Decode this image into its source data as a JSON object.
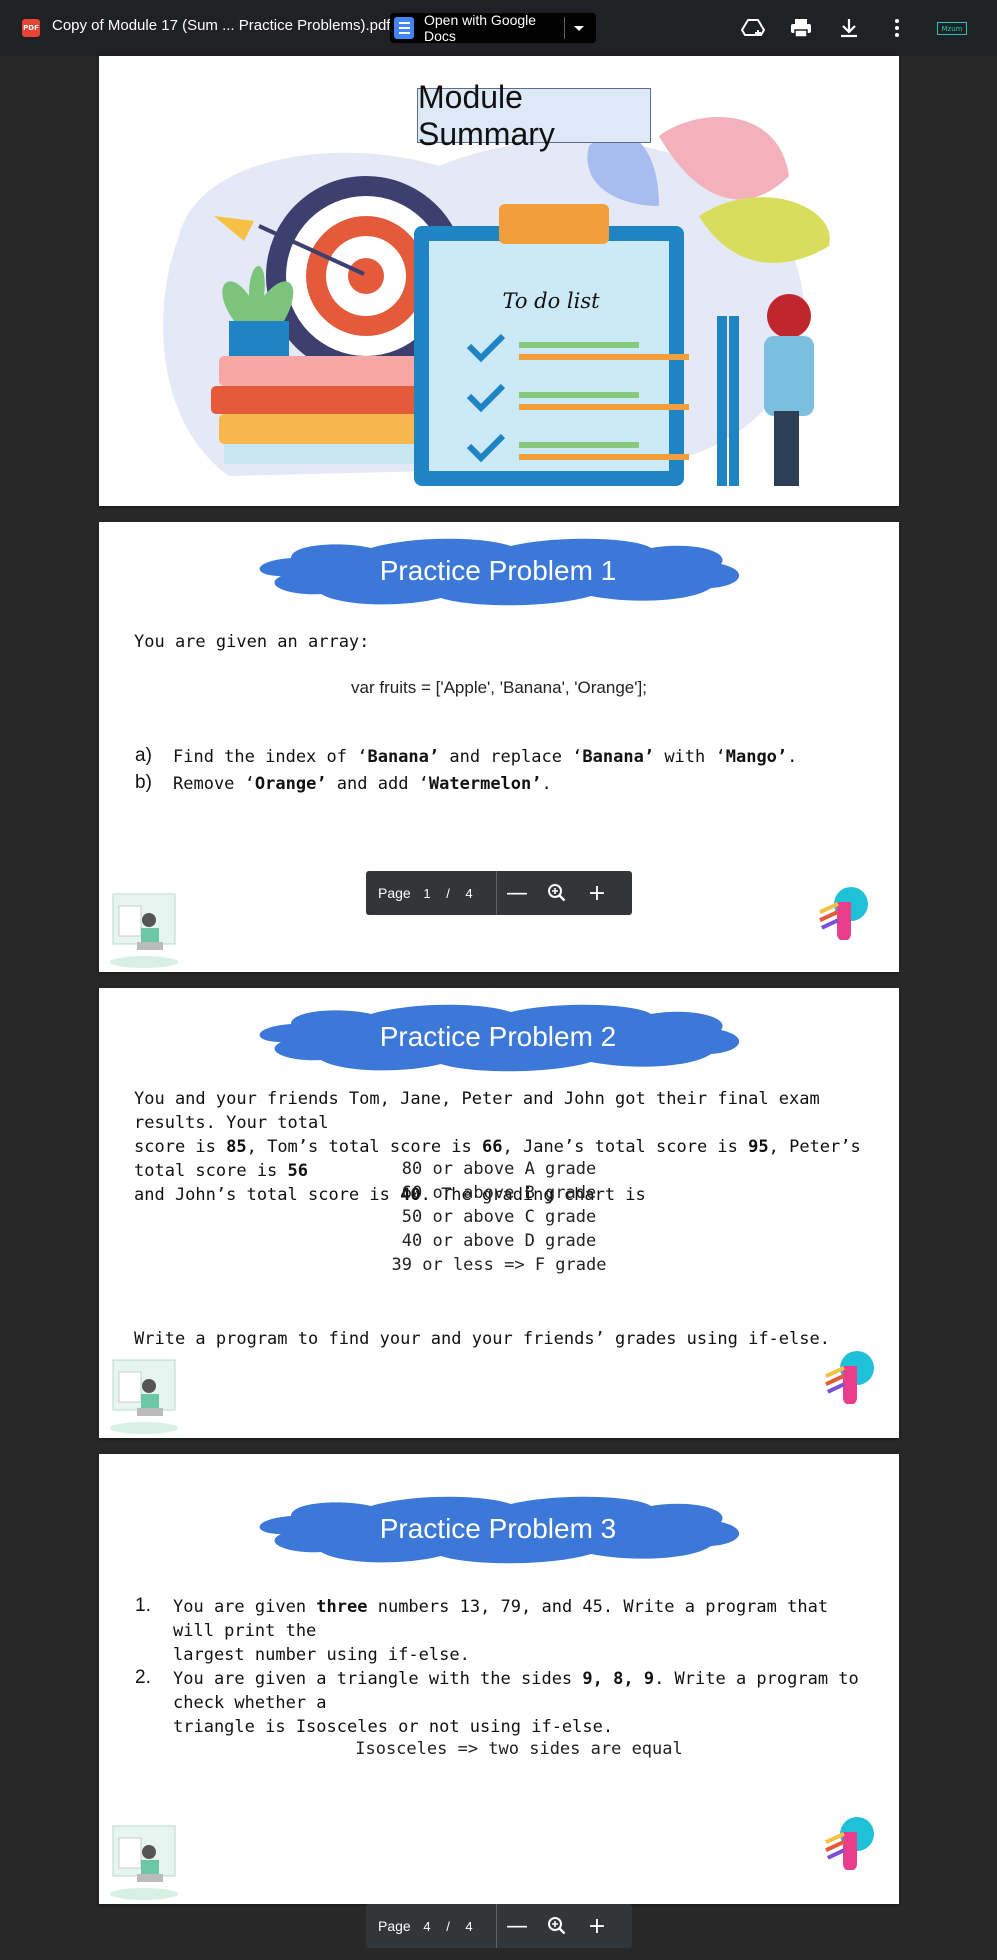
{
  "toolbar": {
    "pdf_badge": "PDF",
    "title": "Copy of Module 17 (Sum ... Practice Problems).pdf",
    "open_with": "Open with Google Docs",
    "ext_badge": "Mzum"
  },
  "slides": {
    "summary": {
      "title": "Module Summary",
      "todo_heading": "To do list"
    },
    "p1": {
      "title": "Practice Problem 1",
      "intro": "You are given an array:",
      "code": "var fruits = ['Apple', 'Banana', 'Orange'];",
      "a_marker": "a)",
      "a_t1": "Find the index of ‘",
      "a_b1": "Banana’",
      "a_t2": " and replace ‘",
      "a_b2": "Banana’",
      "a_t3": "  with ‘",
      "a_b3": "Mango’",
      "a_t4": ".",
      "b_marker": "b)",
      "b_t1": "Remove ‘",
      "b_b1": "Orange’",
      "b_t2": " and add ‘",
      "b_b2": "Watermelon’",
      "b_t3": "."
    },
    "p2": {
      "title": "Practice Problem 2",
      "l1": "You and your friends Tom, Jane, Peter and John got their final exam results. Your total",
      "l2_t1": "score is ",
      "l2_b1": "85",
      "l2_t2": ", Tom’s total score is ",
      "l2_b2": "66",
      "l2_t3": ", Jane’s total score is ",
      "l2_b3": "95",
      "l2_t4": ", Peter’s total score is ",
      "l2_b4": "56",
      "l3_t1": "and John’s total score is ",
      "l3_b1": "40",
      "l3_t2": ". The grading chart is",
      "grades": [
        "80 or above A grade",
        "60 or above B grade",
        "50 or above C grade",
        "40 or above D grade",
        "39 or less => F grade"
      ],
      "closing": "Write a program to find your and your friends’ grades using if-else."
    },
    "p3": {
      "title": "Practice Problem 3",
      "n1": "1.",
      "i1_t1": "You are given ",
      "i1_b1": "three",
      "i1_t2": " numbers 13, 79, and 45. Write a program that will print the",
      "i1_l2": "largest number using if-else.",
      "n2": "2.",
      "i2_t1": "You are given a triangle with the sides ",
      "i2_b1": "9, 8, 9",
      "i2_t2": ". Write a program to check whether a",
      "i2_l2": "triangle is Isosceles or not using if-else.",
      "note": "Isosceles => two sides are equal"
    }
  },
  "pagebar_top": {
    "label": "Page",
    "current": "1",
    "sep": "/",
    "total": "4"
  },
  "pagebar_bottom": {
    "label": "Page",
    "current": "4",
    "sep": "/",
    "total": "4"
  },
  "colors": {
    "cloud": "#3b78d8",
    "toolbar": "#202124",
    "background": "#282828"
  }
}
